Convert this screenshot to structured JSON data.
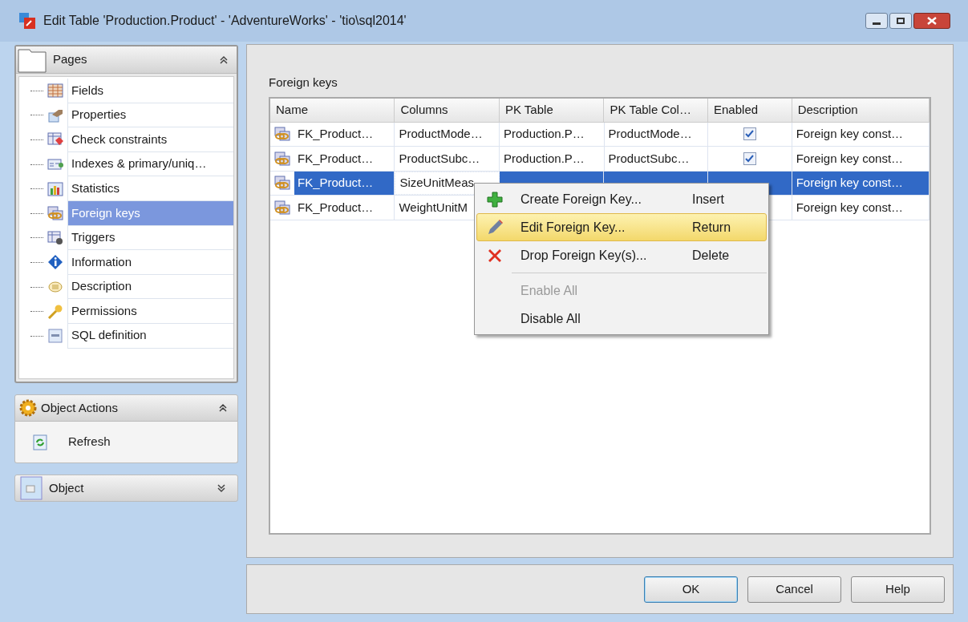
{
  "window": {
    "title": "Edit Table 'Production.Product' - 'AdventureWorks' - 'tio\\sql2014'"
  },
  "pages": {
    "title": "Pages",
    "expanded": true,
    "items": [
      {
        "label": "Fields",
        "kind": "fields",
        "selected": false
      },
      {
        "label": "Properties",
        "kind": "properties",
        "selected": false
      },
      {
        "label": "Check constraints",
        "kind": "check",
        "selected": false
      },
      {
        "label": "Indexes & primary/uniq…",
        "kind": "indexes",
        "selected": false
      },
      {
        "label": "Statistics",
        "kind": "statistics",
        "selected": false
      },
      {
        "label": "Foreign keys",
        "kind": "fkeys",
        "selected": true
      },
      {
        "label": "Triggers",
        "kind": "triggers",
        "selected": false
      },
      {
        "label": "Information",
        "kind": "info",
        "selected": false
      },
      {
        "label": "Description",
        "kind": "description",
        "selected": false
      },
      {
        "label": "Permissions",
        "kind": "permissions",
        "selected": false
      },
      {
        "label": "SQL definition",
        "kind": "sql",
        "selected": false
      }
    ]
  },
  "object_actions": {
    "title": "Object Actions",
    "expanded": true,
    "items": [
      "Refresh"
    ]
  },
  "object": {
    "title": "Object",
    "expanded": false
  },
  "foreign_keys": {
    "title": "Foreign keys",
    "columns": [
      "Name",
      "Columns",
      "PK Table",
      "PK Table Col…",
      "Enabled",
      "Description"
    ],
    "rows": [
      {
        "selected": false,
        "name": "FK_Product…",
        "columns": "ProductMode…",
        "pk_table": "Production.P…",
        "pk_columns": "ProductMode…",
        "enabled": true,
        "description": "Foreign key const…"
      },
      {
        "selected": false,
        "name": "FK_Product…",
        "columns": "ProductSubc…",
        "pk_table": "Production.P…",
        "pk_columns": "ProductSubc…",
        "enabled": true,
        "description": "Foreign key const…"
      },
      {
        "selected": true,
        "name": "FK_Product…",
        "columns": "SizeUnitMeas",
        "description": "Foreign key const…"
      },
      {
        "selected": false,
        "name": "FK_Product…",
        "columns": "WeightUnitM",
        "description": "Foreign key const…"
      }
    ]
  },
  "context_menu": {
    "items": [
      {
        "kind": "item",
        "label": "Create Foreign Key...",
        "shortcut": "Insert",
        "selected": false,
        "disabled": false
      },
      {
        "kind": "item",
        "label": "Edit Foreign Key...",
        "shortcut": "Return",
        "selected": true,
        "disabled": false
      },
      {
        "kind": "item",
        "label": "Drop Foreign Key(s)...",
        "shortcut": "Delete",
        "selected": false,
        "disabled": false
      },
      {
        "kind": "separator"
      },
      {
        "kind": "item",
        "label": "Enable All",
        "selected": false,
        "disabled": true
      },
      {
        "kind": "item",
        "label": "Disable All",
        "selected": false,
        "disabled": false
      }
    ]
  },
  "buttons": [
    {
      "label": "OK",
      "default": true
    },
    {
      "label": "Cancel",
      "default": false
    },
    {
      "label": "Help",
      "default": false
    }
  ]
}
